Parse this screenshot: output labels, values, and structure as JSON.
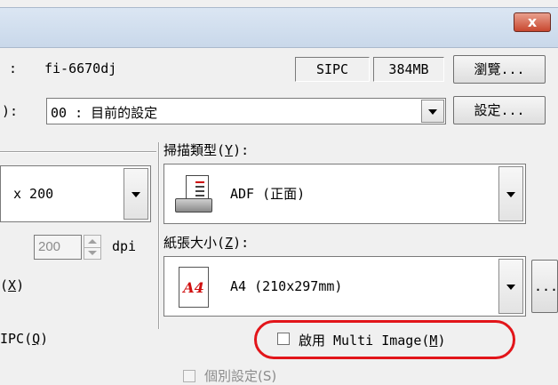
{
  "title_bar": {
    "close_label": "x"
  },
  "scanner": {
    "prefix": ":",
    "name": "fi-6670dj",
    "protocol": "SIPC",
    "memory": "384MB",
    "browse_label": "瀏覽..."
  },
  "profile": {
    "prefix": "):",
    "value": "00 : 目前的設定",
    "settings_label": "設定..."
  },
  "resolution": {
    "value": "x 200",
    "custom_value": "200",
    "unit": "dpi",
    "label_suffix": "(",
    "label_key": "X",
    "label_end": ")"
  },
  "scan_type": {
    "label_text": "掃描類型(",
    "label_key": "Y",
    "label_end": "):",
    "value": "ADF  (正面)"
  },
  "paper_size": {
    "label_text": "紙張大小(",
    "label_key": "Z",
    "label_end": "):",
    "value": "A4 (210x297mm)",
    "icon_text": "A4",
    "more_label": "..."
  },
  "ipc": {
    "label_text": "IPC(",
    "label_key": "Q",
    "label_end": ")"
  },
  "multi_image": {
    "label_text": "啟用 Multi Image(",
    "label_key": "M",
    "label_end": ")",
    "checked": false
  },
  "individual": {
    "label": "個別設定(S)",
    "enabled": false
  },
  "colors": {
    "highlight": "#e2151a",
    "titlebar": "#c9d8ea"
  }
}
